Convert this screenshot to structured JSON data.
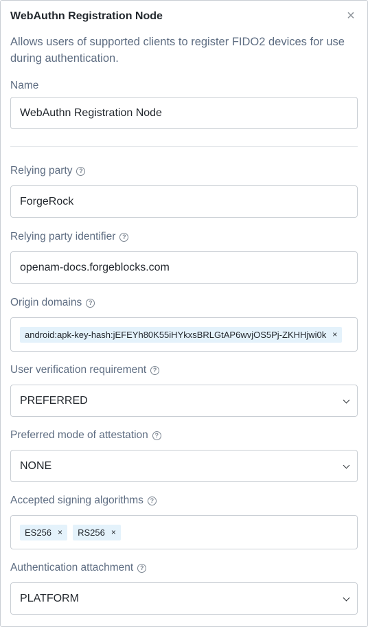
{
  "header": {
    "title": "WebAuthn Registration Node",
    "close_icon": "close-icon"
  },
  "description": "Allows users of supported clients to register FIDO2 devices for use during authentication.",
  "fields": {
    "name": {
      "label": "Name",
      "value": "WebAuthn Registration Node"
    },
    "relying_party": {
      "label": "Relying party",
      "value": "ForgeRock"
    },
    "relying_party_identifier": {
      "label": "Relying party identifier",
      "value": "openam-docs.forgeblocks.com"
    },
    "origin_domains": {
      "label": "Origin domains",
      "chips": [
        "android:apk-key-hash:jEFEYh80K55iHYkxsBRLGtAP6wvjOS5Pj-ZKHHjwi0k"
      ]
    },
    "user_verification": {
      "label": "User verification requirement",
      "value": "PREFERRED"
    },
    "attestation_mode": {
      "label": "Preferred mode of attestation",
      "value": "NONE"
    },
    "signing_algorithms": {
      "label": "Accepted signing algorithms",
      "chips": [
        "ES256",
        "RS256"
      ]
    },
    "authentication_attachment": {
      "label": "Authentication attachment",
      "value": "PLATFORM"
    }
  },
  "icons": {
    "help": "help-circle-icon",
    "remove": "remove-chip-icon",
    "dropdown": "chevron-down-icon"
  },
  "glyphs": {
    "close": "×",
    "help": "?",
    "remove": "×"
  }
}
